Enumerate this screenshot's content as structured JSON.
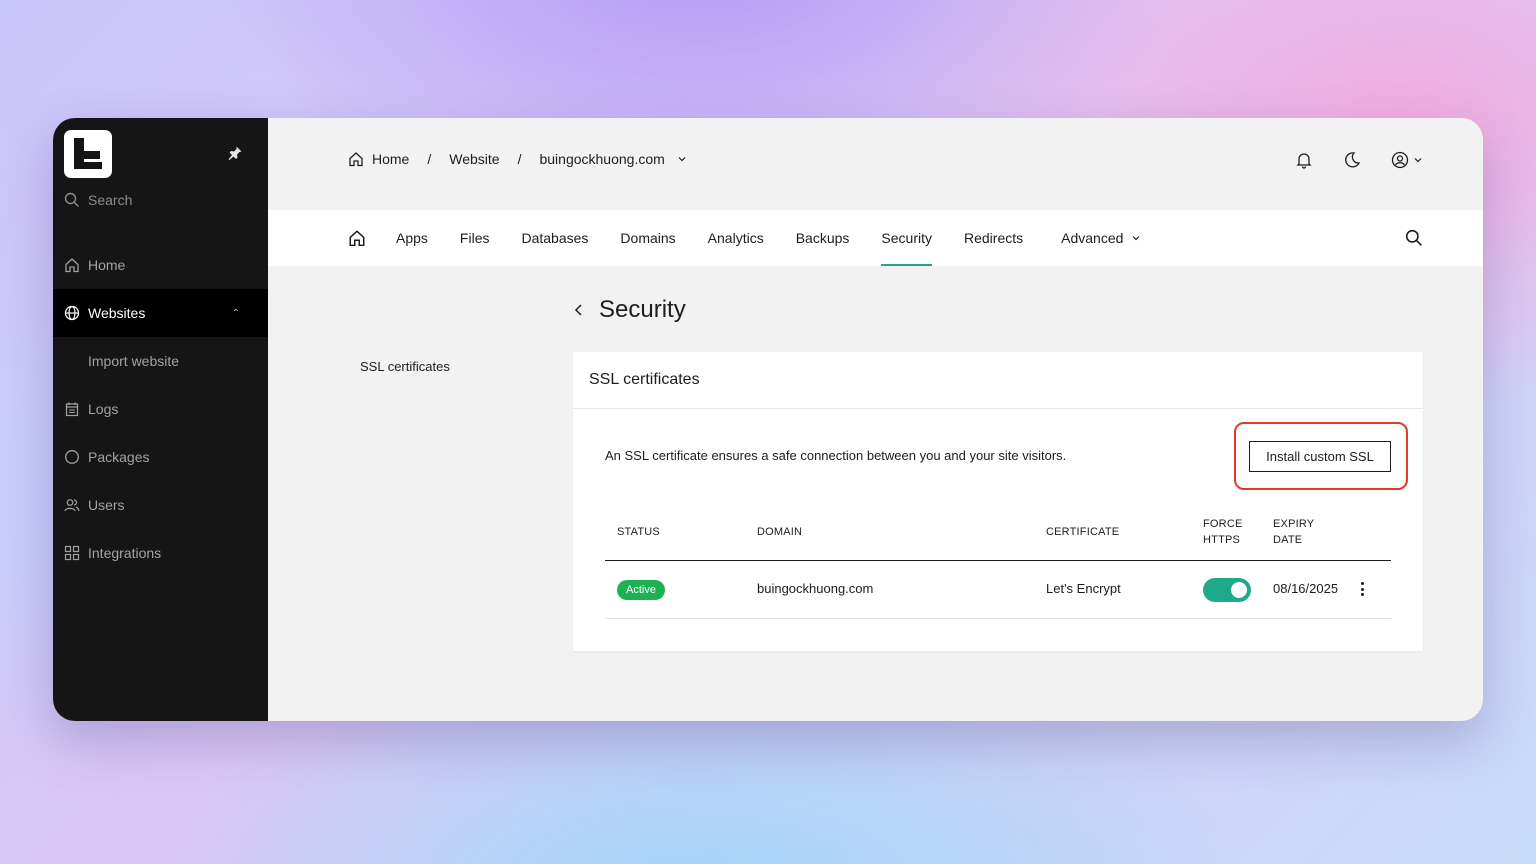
{
  "sidebar": {
    "search_label": "Search",
    "items": [
      {
        "label": "Home",
        "icon": "home-icon"
      },
      {
        "label": "Websites",
        "icon": "globe-icon",
        "active": true,
        "expanded": true
      },
      {
        "label": "Import website",
        "sub": true
      },
      {
        "label": "Logs",
        "icon": "calendar-icon"
      },
      {
        "label": "Packages",
        "icon": "circle-icon"
      },
      {
        "label": "Users",
        "icon": "users-icon"
      },
      {
        "label": "Integrations",
        "icon": "grid-icon"
      }
    ]
  },
  "breadcrumb": {
    "home": "Home",
    "sep": "/",
    "website": "Website",
    "domain": "buingockhuong.com"
  },
  "tabs": {
    "apps": "Apps",
    "files": "Files",
    "databases": "Databases",
    "domains": "Domains",
    "analytics": "Analytics",
    "backups": "Backups",
    "security": "Security",
    "redirects": "Redirects",
    "advanced": "Advanced"
  },
  "page": {
    "title": "Security",
    "side_link": "SSL certificates"
  },
  "card": {
    "title": "SSL certificates",
    "description": "An SSL certificate ensures a safe connection between you and your site visitors.",
    "install_button": "Install custom SSL",
    "columns": {
      "status": "STATUS",
      "domain": "DOMAIN",
      "certificate": "CERTIFICATE",
      "force_https_1": "FORCE",
      "force_https_2": "HTTPS",
      "expiry_1": "EXPIRY",
      "expiry_2": "DATE"
    },
    "rows": [
      {
        "status": "Active",
        "domain": "buingockhuong.com",
        "certificate": "Let's Encrypt",
        "force_https": true,
        "expiry": "08/16/2025"
      }
    ]
  },
  "colors": {
    "accent": "#1fa88a",
    "status_active": "#1cb254",
    "highlight": "#e23a2a",
    "sidebar_bg": "#151515"
  }
}
